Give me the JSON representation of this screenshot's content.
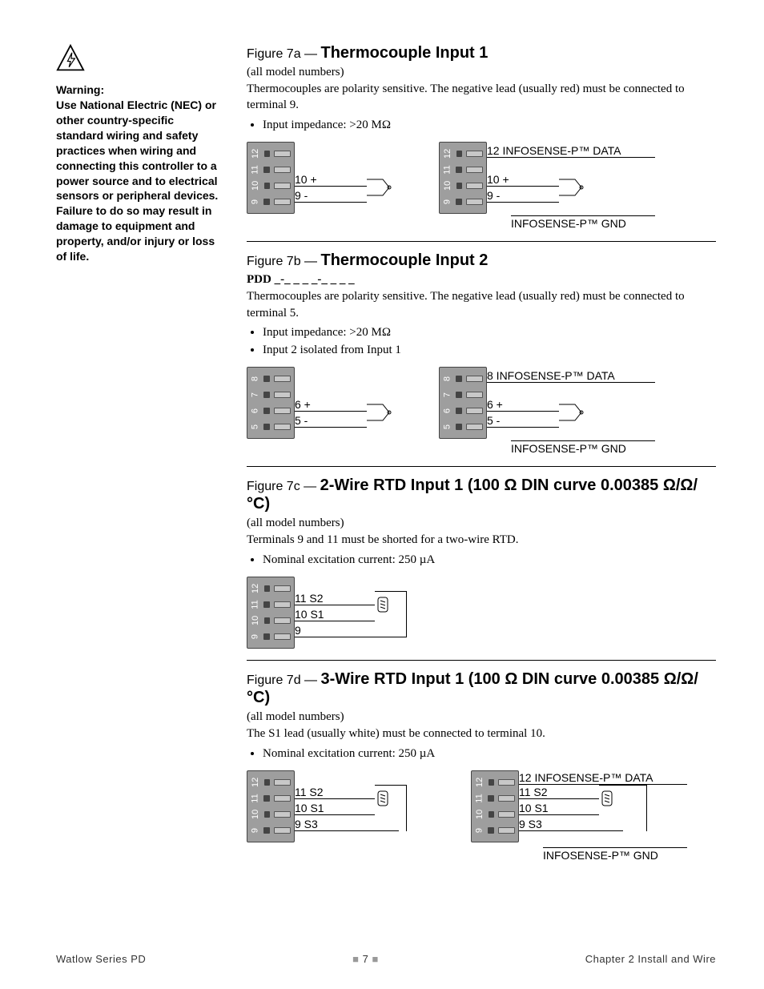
{
  "sidebar": {
    "warning_label": "Warning:",
    "warning_body": "Use National Electric (NEC) or other country-specific standard wiring and safety practices when wiring and connecting this controller to a power source and to electrical sensors or peripheral devices. Failure to do so may result in damage to equipment and property, and/or injury or loss of life."
  },
  "fig7a": {
    "label": "Figure 7a — ",
    "title": "Thermocouple Input 1",
    "sub": "(all model numbers)",
    "note": "Thermocouples are polarity sensitive. The negative lead (usually red) must be connected to terminal 9.",
    "specs": [
      "Input impedance: >20 MΩ"
    ],
    "terminals": [
      "9",
      "10",
      "11",
      "12"
    ],
    "pins": {
      "plus": "10  +",
      "minus": "9  -"
    },
    "infosense_data": "12  INFOSENSE-P™ DATA",
    "infosense_gnd": "INFOSENSE-P™ GND"
  },
  "fig7b": {
    "label": "Figure 7b — ",
    "title": "Thermocouple Input 2",
    "code": "PDD _-_ _ _ _-_ _ _ _",
    "note": "Thermocouples are polarity sensitive. The negative lead (usually red) must be connected to terminal 5.",
    "specs": [
      "Input impedance: >20 MΩ",
      "Input 2 isolated from Input 1"
    ],
    "terminals": [
      "5",
      "6",
      "7",
      "8"
    ],
    "pins": {
      "plus": "6  +",
      "minus": "5  -"
    },
    "infosense_data": "8  INFOSENSE-P™ DATA",
    "infosense_gnd": "INFOSENSE-P™ GND"
  },
  "fig7c": {
    "label": "Figure 7c — ",
    "title": "2-Wire RTD Input 1 (100 Ω DIN curve 0.00385 Ω/Ω/°C)",
    "sub": "(all model numbers)",
    "note": "Terminals 9 and 11 must be shorted for a two-wire RTD.",
    "specs": [
      "Nominal excitation current: 250 µA"
    ],
    "terminals": [
      "9",
      "10",
      "11",
      "12"
    ],
    "pins": {
      "s2": "11  S2",
      "s1": "10  S1",
      "s3": "9"
    }
  },
  "fig7d": {
    "label": "Figure 7d — ",
    "title": "3-Wire RTD Input 1 (100 Ω DIN curve 0.00385 Ω/Ω/°C)",
    "sub": "(all model numbers)",
    "note": "The S1 lead (usually white) must be connected to terminal 10.",
    "specs": [
      "Nominal excitation current: 250 µA"
    ],
    "terminals": [
      "9",
      "10",
      "11",
      "12"
    ],
    "pins": {
      "t12": "12",
      "s2": "11  S2",
      "s1": "10  S1",
      "s3": "9  S3"
    },
    "infosense_data": "12  INFOSENSE-P™ DATA",
    "infosense_gnd": "INFOSENSE-P™ GND"
  },
  "footer": {
    "left": "Watlow Series PD",
    "mid": "7",
    "right": "Chapter 2 Install and Wire"
  }
}
